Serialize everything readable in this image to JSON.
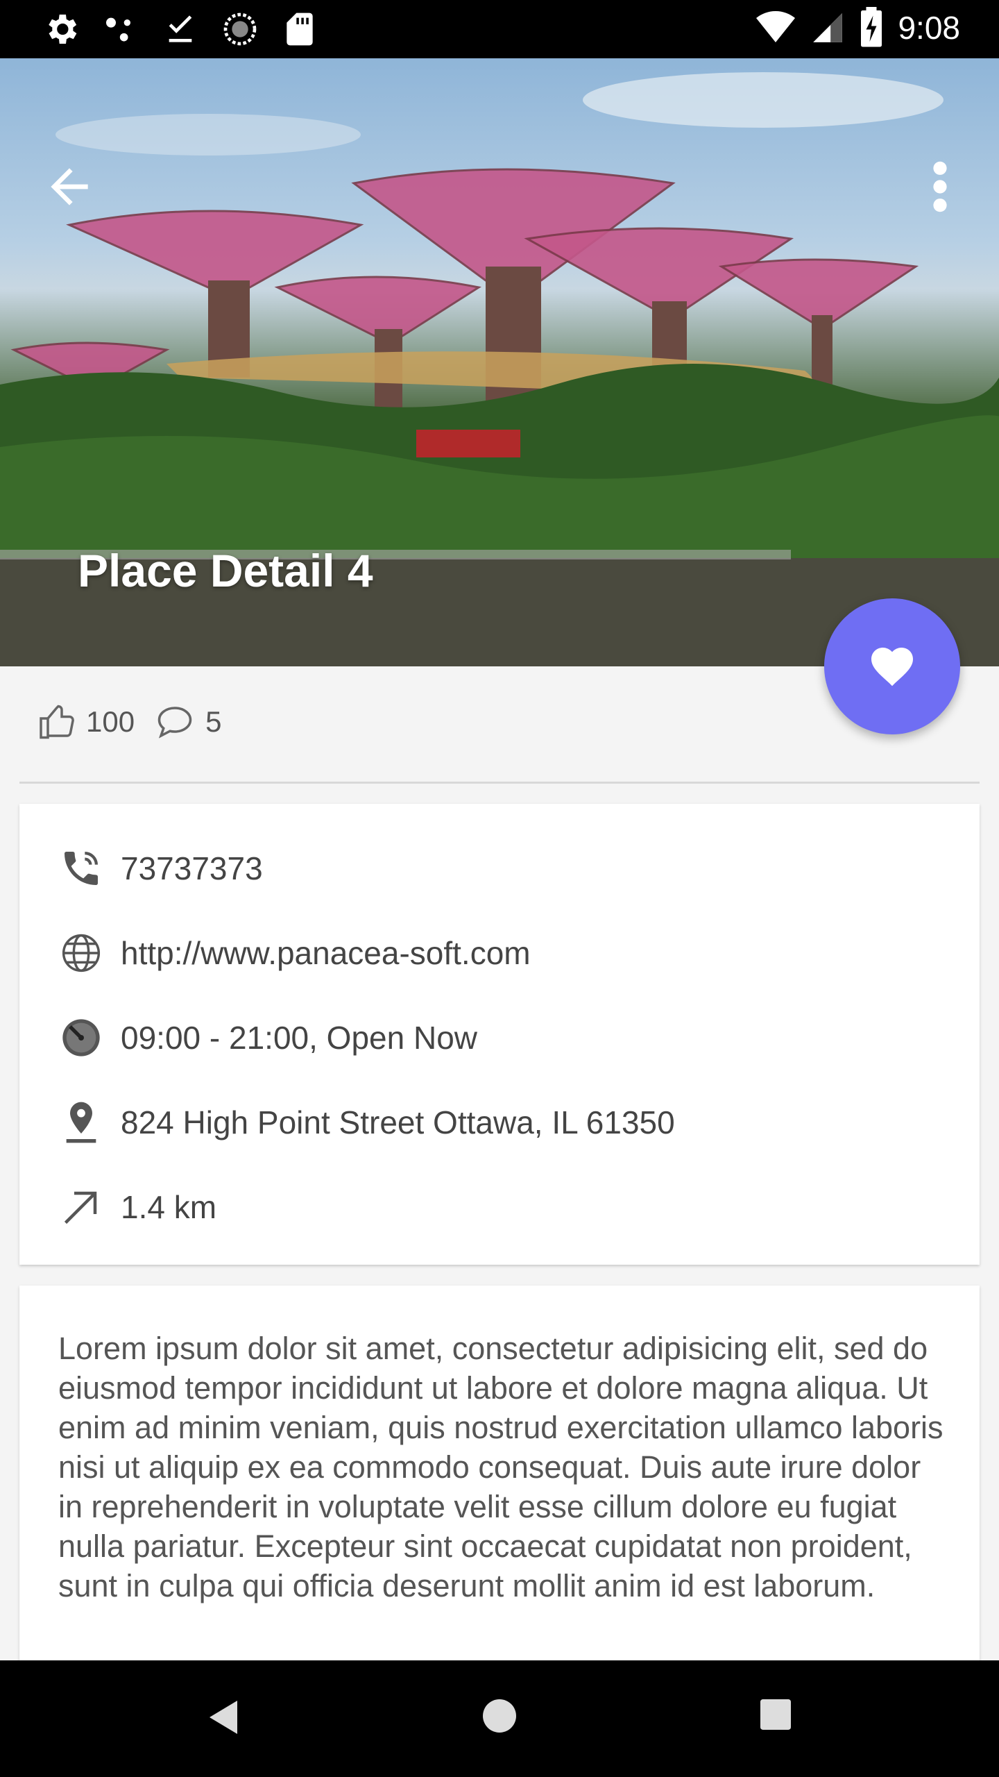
{
  "status_bar": {
    "time": "9:08",
    "left_icons": [
      "settings-icon",
      "dots-icon",
      "download-done-icon",
      "sync-icon",
      "sd-card-icon"
    ],
    "right_icons": [
      "wifi-icon",
      "signal-icon",
      "battery-charging-icon"
    ]
  },
  "hero": {
    "title": "Place Detail 4"
  },
  "stats": {
    "likes": "100",
    "comments": "5"
  },
  "info": {
    "phone": "73737373",
    "website": "http://www.panacea-soft.com",
    "hours": "09:00 - 21:00, Open Now",
    "address": "824 High Point Street Ottawa, IL 61350",
    "distance": "1.4 km"
  },
  "description": "Lorem ipsum dolor sit amet, consectetur adipisicing elit, sed do eiusmod tempor incididunt ut labore et dolore magna aliqua. Ut enim ad minim veniam, quis nostrud exercitation ullamco laboris nisi ut aliquip ex ea commodo consequat. Duis aute irure dolor in reprehenderit in voluptate velit esse cillum dolore eu fugiat nulla pariatur. Excepteur sint occaecat cupidatat non proident, sunt in culpa qui officia deserunt mollit anim id est laborum.",
  "colors": {
    "fab": "#6f6ef3",
    "text": "#444444"
  }
}
